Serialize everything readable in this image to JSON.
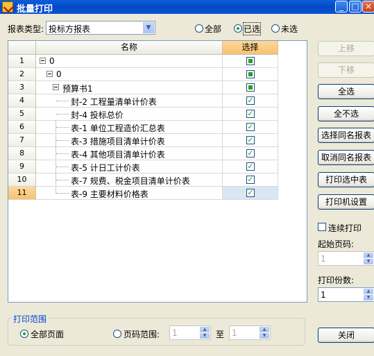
{
  "window": {
    "title": "批量打印"
  },
  "report_type": {
    "label": "报表类型:",
    "value": "投标方报表"
  },
  "filter": {
    "options": [
      {
        "label": "全部",
        "selected": false
      },
      {
        "label": "已选",
        "selected": true
      },
      {
        "label": "未选",
        "selected": false
      }
    ]
  },
  "grid": {
    "columns": {
      "name": "名称",
      "select": "选择"
    },
    "rows": [
      {
        "num": "1",
        "name": "0",
        "state": "partial"
      },
      {
        "num": "2",
        "name": "0",
        "state": "partial"
      },
      {
        "num": "3",
        "name": "预算书1",
        "state": "partial"
      },
      {
        "num": "4",
        "name": "封-2 工程量清单计价表",
        "state": "checked"
      },
      {
        "num": "5",
        "name": "封-4 投标总价",
        "state": "checked"
      },
      {
        "num": "6",
        "name": "表-1 单位工程造价汇总表",
        "state": "checked"
      },
      {
        "num": "7",
        "name": "表-3 措施项目清单计价表",
        "state": "checked"
      },
      {
        "num": "8",
        "name": "表-4 其他项目清单计价表",
        "state": "checked"
      },
      {
        "num": "9",
        "name": "表-5 计日工计价表",
        "state": "checked"
      },
      {
        "num": "10",
        "name": "表-7 规费、税金项目清单计价表",
        "state": "checked"
      },
      {
        "num": "11",
        "name": "表-9 主要材料价格表",
        "state": "checked"
      }
    ]
  },
  "buttons": {
    "move_up": "上移",
    "move_down": "下移",
    "select_all": "全选",
    "select_none": "全不选",
    "select_same": "选择同名报表",
    "cancel_same": "取消同名报表",
    "print_selected": "打印选中表",
    "printer_settings": "打印机设置",
    "close": "关闭"
  },
  "continuous_print": {
    "label": "连续打印",
    "checked": false
  },
  "start_page": {
    "label": "起始页码:",
    "value": "1"
  },
  "copies": {
    "label": "打印份数:",
    "value": "1"
  },
  "print_range": {
    "title": "打印范围",
    "all_pages": "全部页面",
    "page_range": "页码范围:",
    "from": "1",
    "to_label": "至",
    "to": "1"
  },
  "colors": {
    "title_bar": "#0a5fd9",
    "dialog_bg": "#ece9d8",
    "header_highlight": "#f7c270",
    "check": "#21a121"
  }
}
